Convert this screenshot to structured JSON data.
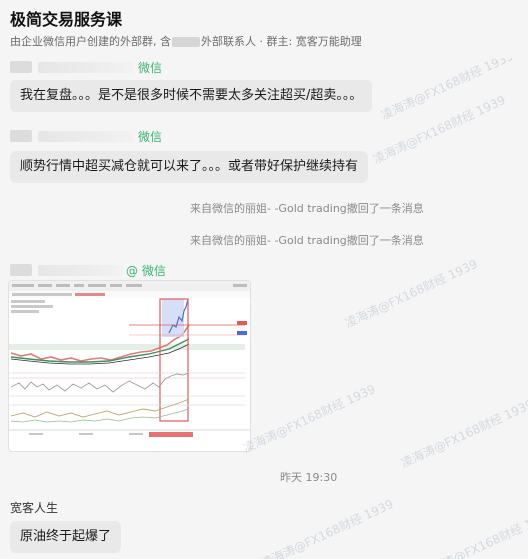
{
  "header": {
    "title": "极简交易服务课",
    "subtitle_prefix": "由企业微信用户创建的外部群, 含",
    "subtitle_suffix": "外部联系人 · 群主: 宽客万能助理"
  },
  "messages": [
    {
      "sender_tag": "微信",
      "text": "我在复盘。。。是不是很多时候不需要太多关注超买/超卖。。。"
    },
    {
      "sender_tag": "微信",
      "text": "顺势行情中超买减仓就可以来了。。。或者带好保护继续持有"
    }
  ],
  "system_notices": [
    "来自微信的丽姐- -Gold trading撤回了一条消息",
    "来自微信的丽姐- -Gold trading撤回了一条消息"
  ],
  "image_message": {
    "sender_tag": "@ 微信"
  },
  "timestamp": "昨天 19:30",
  "last_message": {
    "sender": "宽客人生",
    "text": "原油终于起爆了"
  },
  "watermark_text": "凌海涛@FX168财经 1939",
  "colors": {
    "wechat_green": "#3cb371",
    "bubble_bg": "#e9e9e9",
    "page_bg": "#f5f5f5"
  }
}
